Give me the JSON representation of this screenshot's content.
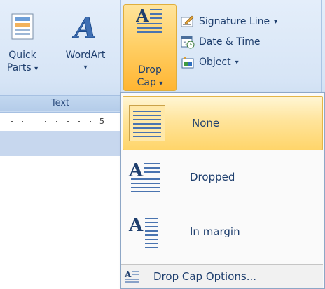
{
  "ribbon": {
    "buttons": {
      "quick_parts": {
        "line1": "Quick",
        "line2": "Parts",
        "arrow": "▾",
        "icon": "quick-parts-icon"
      },
      "wordart": {
        "line1": "WordArt",
        "arrow": "▾",
        "icon": "wordart-icon"
      },
      "drop_cap": {
        "line1": "Drop",
        "line2": "Cap",
        "arrow": "▾",
        "icon": "drop-cap-icon"
      },
      "signature_line": {
        "label": "Signature Line",
        "arrow": "▾",
        "icon": "signature-line-icon"
      },
      "date_time": {
        "label": "Date & Time",
        "icon": "date-time-icon"
      },
      "object": {
        "label": "Object",
        "arrow": "▾",
        "icon": "object-icon"
      }
    },
    "group_label": "Text"
  },
  "ruler": {
    "number": "5"
  },
  "dropdown": {
    "items": [
      {
        "label": "None",
        "icon": "drop-cap-none-icon",
        "state": "highlighted"
      },
      {
        "label": "Dropped",
        "icon": "drop-cap-dropped-icon"
      },
      {
        "label": "In margin",
        "icon": "drop-cap-in-margin-icon"
      }
    ],
    "options": {
      "access_key": "D",
      "rest": "rop Cap Options...",
      "icon": "drop-cap-options-icon"
    }
  },
  "colors": {
    "ribbon_text": "#1f3f6e",
    "highlight": "#ffd56a",
    "highlight_border": "#e3b548",
    "menu_bg": "#fafafa"
  }
}
